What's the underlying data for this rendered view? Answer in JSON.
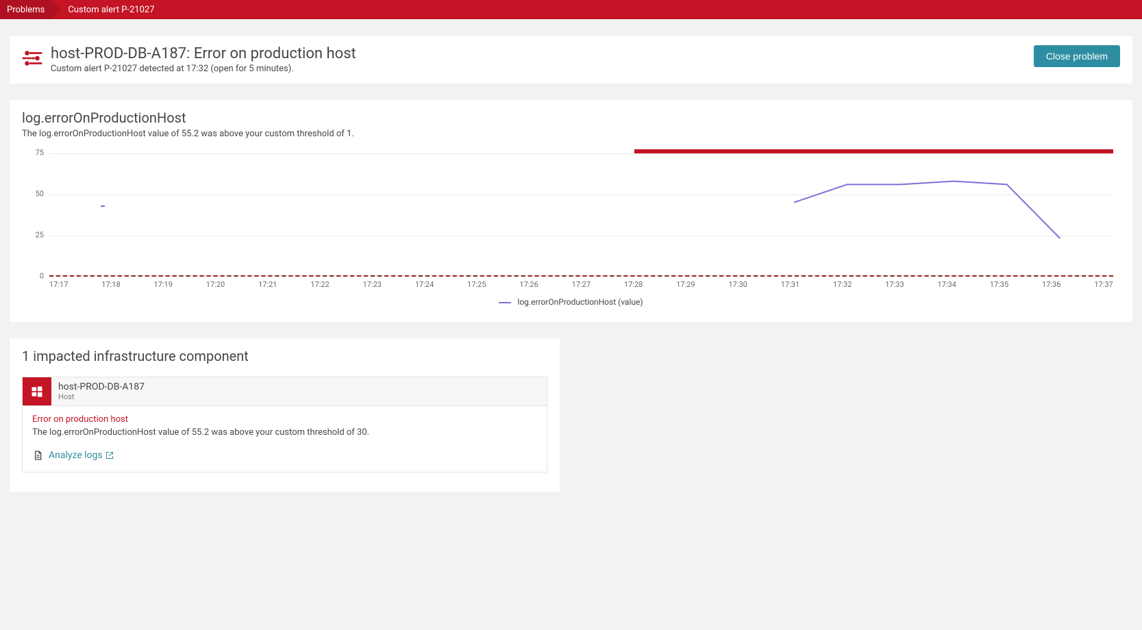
{
  "breadcrumb": {
    "root": "Problems",
    "current": "Custom alert P-21027"
  },
  "header": {
    "title": "host-PROD-DB-A187: Error on production host",
    "subtitle": "Custom alert P-21027 detected at 17:32 (open for 5 minutes).",
    "close_button": "Close problem"
  },
  "chart": {
    "title": "log.errorOnProductionHost",
    "description": "The log.errorOnProductionHost value of 55.2 was above your custom threshold of 1.",
    "legend": "log.errorOnProductionHost (value)"
  },
  "chart_data": {
    "type": "line",
    "x": [
      "17:17",
      "17:18",
      "17:19",
      "17:20",
      "17:21",
      "17:22",
      "17:23",
      "17:24",
      "17:25",
      "17:26",
      "17:27",
      "17:28",
      "17:29",
      "17:30",
      "17:31",
      "17:32",
      "17:33",
      "17:34",
      "17:35",
      "17:36",
      "17:37"
    ],
    "y_ticks": [
      0,
      25,
      50,
      75
    ],
    "threshold": 1,
    "isolated_point": {
      "x": "17:18",
      "y": 43
    },
    "marker_bar": {
      "start": "17:28",
      "end": "17:37"
    },
    "series": [
      {
        "name": "log.errorOnProductionHost (value)",
        "points": [
          {
            "x": "17:31",
            "y": 45
          },
          {
            "x": "17:32",
            "y": 56
          },
          {
            "x": "17:33",
            "y": 56
          },
          {
            "x": "17:34",
            "y": 58
          },
          {
            "x": "17:35",
            "y": 56
          },
          {
            "x": "17:36",
            "y": 23
          }
        ]
      }
    ],
    "ylim": [
      0,
      75
    ],
    "xlabel": "",
    "ylabel": ""
  },
  "impacted": {
    "title": "1 impacted infrastructure component",
    "host_name": "host-PROD-DB-A187",
    "host_type": "Host",
    "error_title": "Error on production host",
    "error_desc": "The log.errorOnProductionHost value of 55.2 was above your custom threshold of 30.",
    "analyze_label": "Analyze logs"
  },
  "colors": {
    "brand_red": "#c41425",
    "teal": "#2e8ea1",
    "series": "#7e6fd6"
  }
}
